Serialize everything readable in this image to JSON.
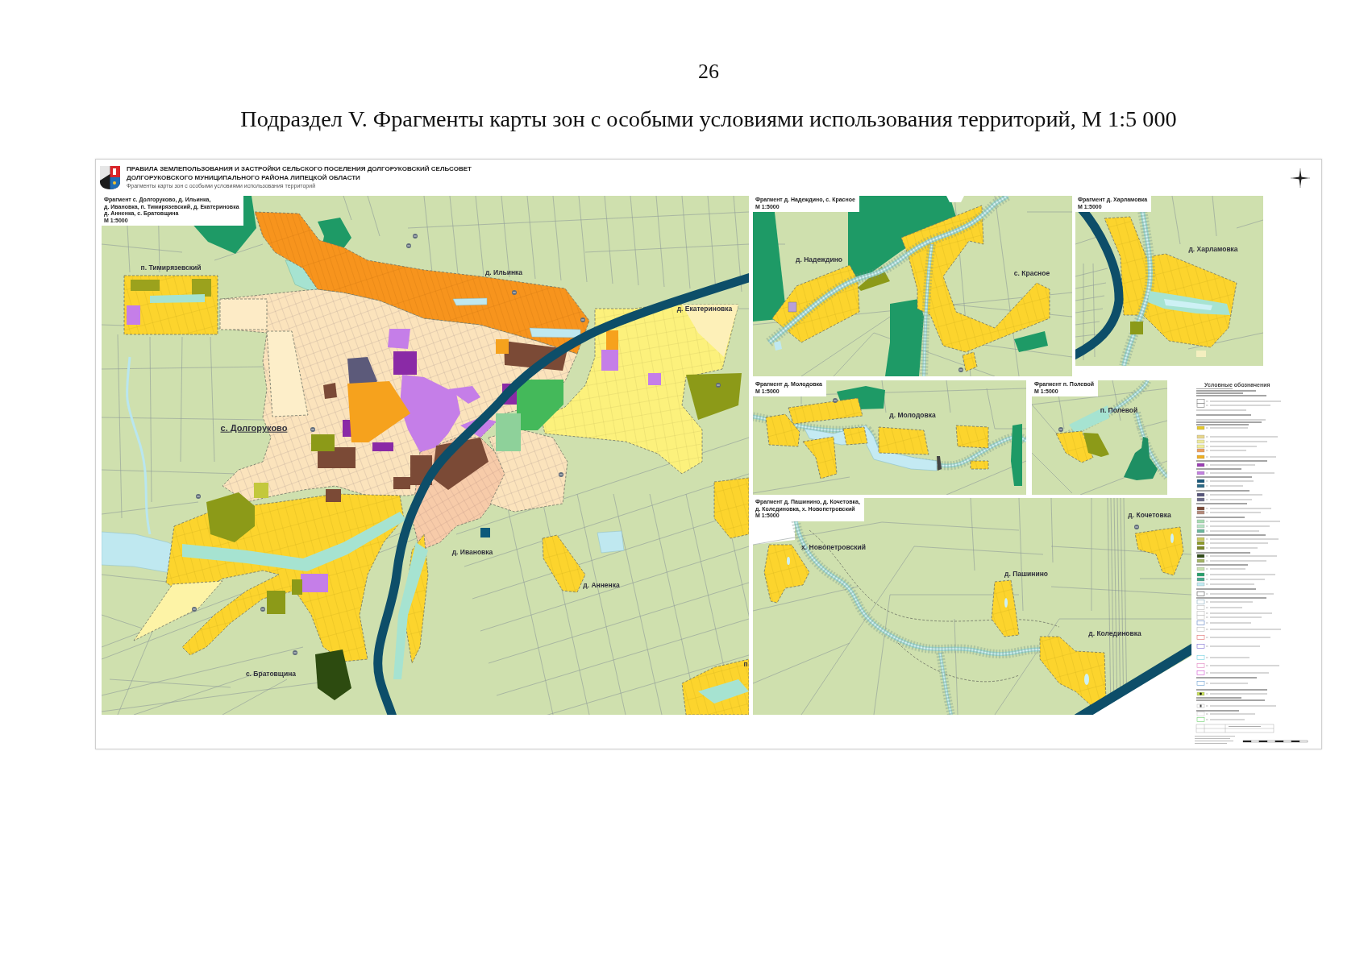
{
  "page_number": "26",
  "heading": "Подраздел V. Фрагменты карты зон с особыми условиями использования территорий, М 1:5 000",
  "map_sheet": {
    "title_lines": [
      "ПРАВИЛА ЗЕМЛЕПОЛЬЗОВАНИЯ И ЗАСТРОЙКИ СЕЛЬСКОГО ПОСЕЛЕНИЯ ДОЛГОРУКОВСКИЙ СЕЛЬСОВЕТ",
      "ДОЛГОРУКОВСКОГО МУНИЦИПАЛЬНОГО РАЙОНА ЛИПЕЦКОЙ ОБЛАСТИ"
    ],
    "subtitle": "Фрагменты карты зон с особыми условиями использования территорий",
    "fragments": [
      {
        "caption": [
          "Фрагмент с. Долгоруково, д. Ильинка,",
          "д. Ивановка, п. Тимирязевский, д. Екатериновка",
          "д. Анненка, с. Братовщина"
        ],
        "scale": "М 1:5000",
        "places": [
          {
            "name": "п. Тимирязевский",
            "kind": "village"
          },
          {
            "name": "д. Ильинка",
            "kind": "village"
          },
          {
            "name": "д. Екатериновка",
            "kind": "village"
          },
          {
            "name": "с. Долгоруково",
            "kind": "center"
          },
          {
            "name": "д. Ивановка",
            "kind": "village"
          },
          {
            "name": "д. Анненка",
            "kind": "village"
          },
          {
            "name": "п",
            "kind": "village"
          },
          {
            "name": "с. Братовщина",
            "kind": "village"
          }
        ]
      },
      {
        "caption": [
          "Фрагмент д. Надеждино, с. Красное"
        ],
        "scale": "М 1:5000",
        "places": [
          {
            "name": "д. Надеждино",
            "kind": "village"
          },
          {
            "name": "с. Красное",
            "kind": "village"
          }
        ]
      },
      {
        "caption": [
          "Фрагмент д. Харламовка"
        ],
        "scale": "М 1:5000",
        "places": [
          {
            "name": "д. Харламовка",
            "kind": "village"
          }
        ]
      },
      {
        "caption": [
          "Фрагмент д. Молодовка"
        ],
        "scale": "М 1:5000",
        "places": [
          {
            "name": "д. Молодовка",
            "kind": "village"
          }
        ]
      },
      {
        "caption": [
          "Фрагмент п. Полевой"
        ],
        "scale": "М 1:5000",
        "places": [
          {
            "name": "п. Полевой",
            "kind": "village"
          }
        ]
      },
      {
        "caption": [
          "Фрагмент д. Пашинино, д. Кочетовка,",
          "д. Колединовка, х. Новопетровский"
        ],
        "scale": "М 1:5000",
        "places": [
          {
            "name": "д. Кочетовка",
            "kind": "village"
          },
          {
            "name": "х. Новопетровский",
            "kind": "village"
          },
          {
            "name": "д. Пашинино",
            "kind": "village"
          },
          {
            "name": "д. Колединовка",
            "kind": "village"
          }
        ]
      }
    ],
    "legend": {
      "title": "Условные обозначения"
    }
  }
}
